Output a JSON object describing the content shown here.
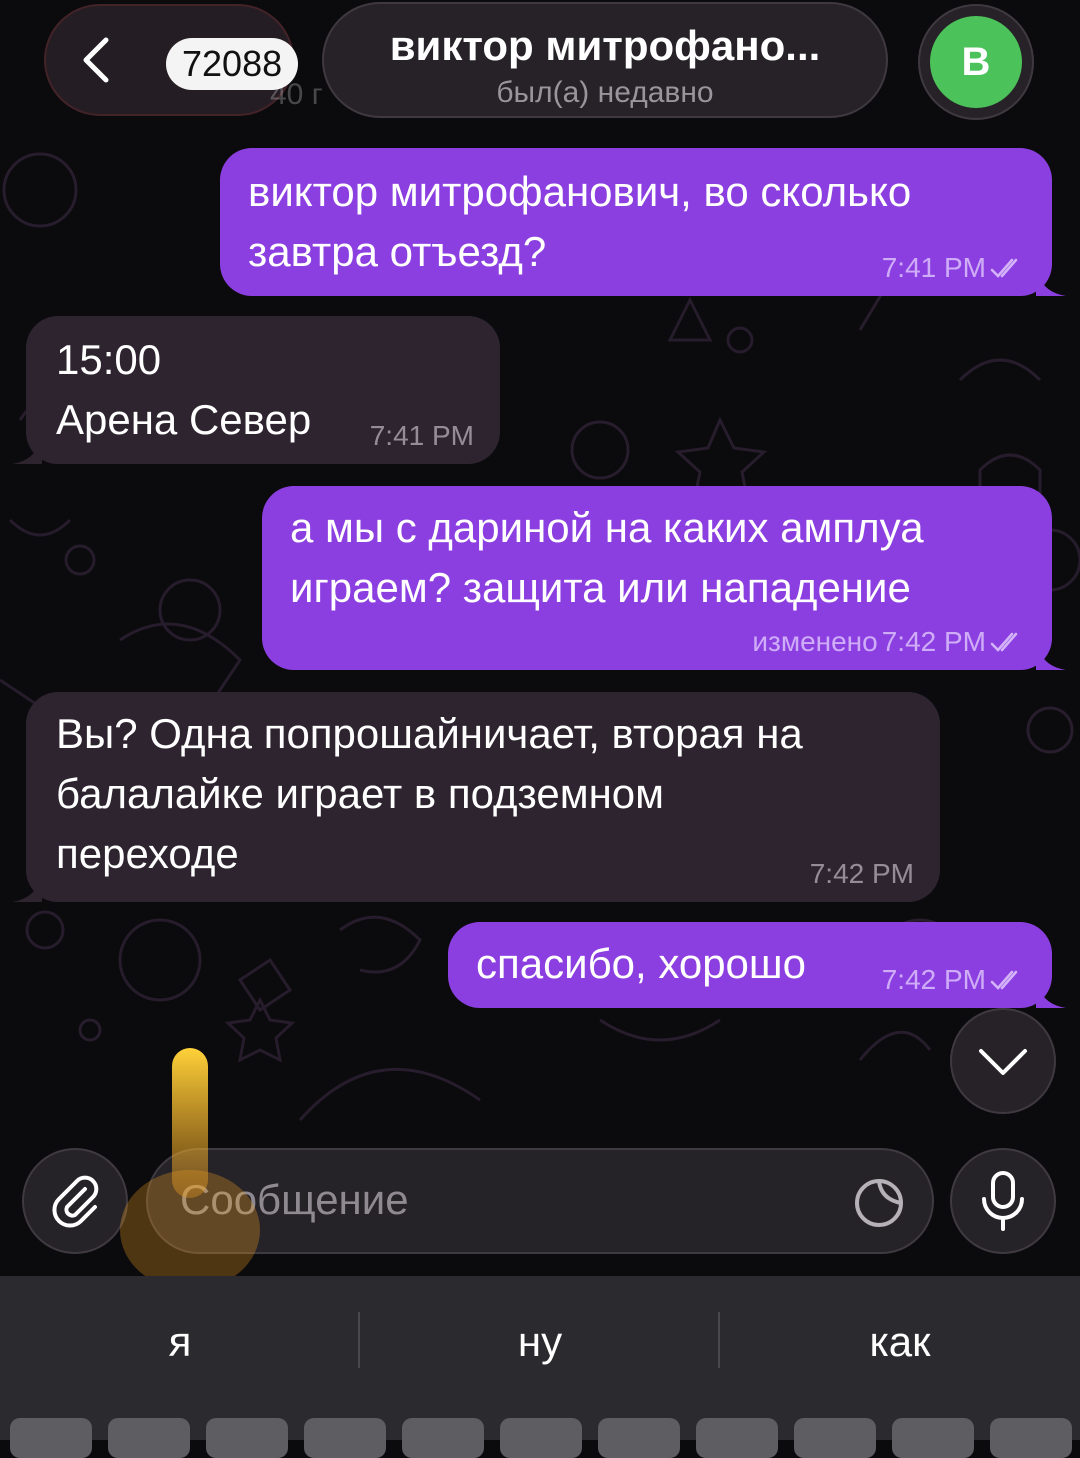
{
  "header": {
    "back_count": "72088",
    "ghost_text": "40 г",
    "title": "виктор митрофано...",
    "status": "был(а) недавно",
    "avatar_letter": "В"
  },
  "messages": [
    {
      "direction": "out",
      "text_lines": [
        "виктор митрофанович, во сколько",
        "завтра отъезд?"
      ],
      "time": "7:41 PM",
      "edited": "",
      "read": true
    },
    {
      "direction": "in",
      "text_lines": [
        "15:00",
        "Арена Север"
      ],
      "time": "7:41 PM",
      "edited": "",
      "read": false
    },
    {
      "direction": "out",
      "text_lines": [
        "а мы с дариной на каких амплуа",
        "играем? защита или нападение"
      ],
      "time": "7:42 PM",
      "edited": "изменено",
      "read": true
    },
    {
      "direction": "in",
      "text_lines": [
        "Вы? Одна попрошайничает, вторая на",
        "балалайке играет в подземном",
        "переходе"
      ],
      "time": "7:42 PM",
      "edited": "",
      "read": false
    },
    {
      "direction": "out",
      "text_lines": [
        "спасибо, хорошо"
      ],
      "time": "7:42 PM",
      "edited": "",
      "read": true
    }
  ],
  "composer": {
    "placeholder": "Сообщение"
  },
  "keyboard": {
    "suggestions": [
      "я",
      "ну",
      "как"
    ]
  },
  "colors": {
    "outgoing_bubble": "#8c3fe0",
    "incoming_bubble": "#2e2430",
    "avatar": "#4cc25a",
    "background": "#0b0a0d"
  },
  "icons": {
    "back": "chevron-left-icon",
    "attach": "paperclip-icon",
    "sticker": "sticker-icon",
    "mic": "microphone-icon",
    "scroll": "chevron-down-icon",
    "read": "double-check-icon"
  }
}
